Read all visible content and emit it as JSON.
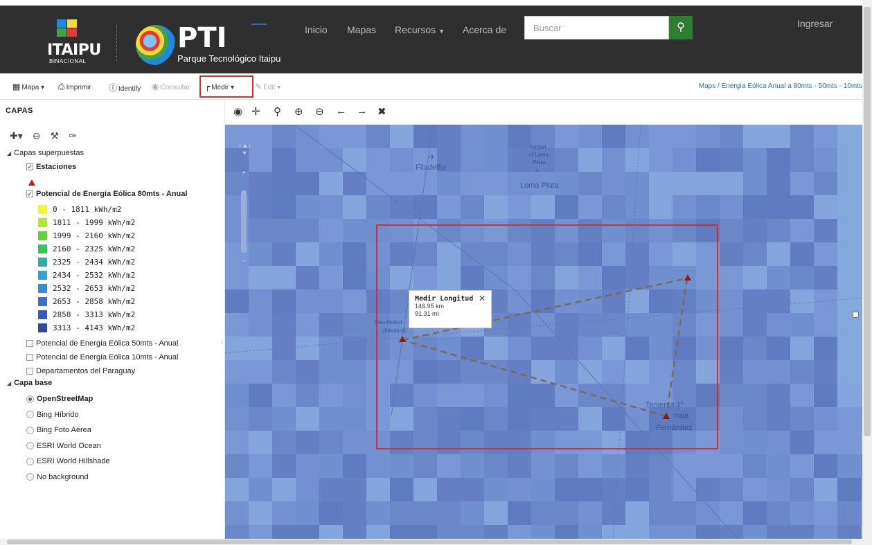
{
  "header": {
    "itaipu_logo_text": "ITAIPU",
    "itaipu_logo_sub": "BINACIONAL",
    "pti_logo_text": "PTI",
    "pti_logo_sub": "Parque Tecnológico Itaipu",
    "nav": [
      {
        "label": "Inicio"
      },
      {
        "label": "Mapas"
      },
      {
        "label": "Recursos",
        "has_dropdown": true
      },
      {
        "label": "Acerca de"
      }
    ],
    "search_placeholder": "Buscar",
    "login_label": "Ingresar"
  },
  "toolbar": {
    "mapa": "Mapa",
    "imprimir": "Imprimir",
    "identify": "Identify",
    "consultar": "Consultar",
    "medir": "Medir",
    "edit": "Edit",
    "breadcrumb": "Maps / Energía Eólica Anual a 80mts - 50mts - 10mts"
  },
  "sidebar": {
    "title": "CAPAS",
    "group_overlays": "Capas superpuestas",
    "layer_stations": "Estaciones",
    "layer_wind80": "Potencial de Energía Eólica 80mts - Anual",
    "legend": [
      {
        "label": "0 - 1811 kWh/m2",
        "color": "#f4f43a"
      },
      {
        "label": "1811 - 1999 kWh/m2",
        "color": "#aee63c"
      },
      {
        "label": "1999 - 2160 kWh/m2",
        "color": "#5fd13a"
      },
      {
        "label": "2160 - 2325 kWh/m2",
        "color": "#39c455"
      },
      {
        "label": "2325 - 2434 kWh/m2",
        "color": "#2fae9b"
      },
      {
        "label": "2434 - 2532 kWh/m2",
        "color": "#38a0d8"
      },
      {
        "label": "2532 - 2653 kWh/m2",
        "color": "#3a8bd6"
      },
      {
        "label": "2653 - 2858 kWh/m2",
        "color": "#3d6fc9"
      },
      {
        "label": "2858 - 3313 kWh/m2",
        "color": "#3a5ab8"
      },
      {
        "label": "3313 - 4143 kWh/m2",
        "color": "#34479f"
      }
    ],
    "layer_wind50": "Potencial de Energía Eólica 50mts - Anual",
    "layer_wind10": "Potencial de Energía Eólica 10mts - Anual",
    "layer_departments": "Departamentos del Paraguay",
    "group_base": "Capa base",
    "base_layers": [
      {
        "label": "OpenStreetMap",
        "selected": true
      },
      {
        "label": "Bing Híbrido",
        "selected": false
      },
      {
        "label": "Bing Foto Aérea",
        "selected": false
      },
      {
        "label": "ESRI World Ocean",
        "selected": false
      },
      {
        "label": "ESRI World Hillshade",
        "selected": false
      },
      {
        "label": "No background",
        "selected": false
      }
    ]
  },
  "map": {
    "labels": {
      "filadelfia": "Filadelfia",
      "airport": "Airport",
      "of_loma": "of Loma",
      "plata_small": "Plata",
      "loma_plata": "Loma Plata",
      "neu_halbstadt": "Neu-Halbst",
      "neuland": "(Neuland)",
      "teniente": "Teniente 1°",
      "irala": "Irala",
      "fernandez": "Fernández"
    },
    "measure_popup": {
      "title": "Medir Longitud",
      "km": "146.95 km",
      "mi": "91.31 mi"
    },
    "measure_color": "#d32f2f"
  },
  "colors": {
    "header_bg": "#2f2f2f",
    "search_button": "#2e7d32",
    "map_base": "#6d8ccc",
    "link": "#2a6ebb"
  }
}
